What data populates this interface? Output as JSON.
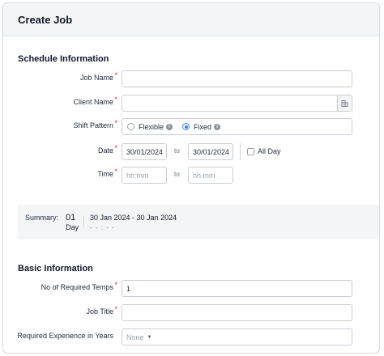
{
  "modal": {
    "title": "Create Job"
  },
  "schedule": {
    "section_title": "Schedule Information",
    "job_name": {
      "label": "Job Name",
      "value": ""
    },
    "client_name": {
      "label": "Client Name",
      "value": ""
    },
    "shift_pattern": {
      "label": "Shift Pattern",
      "options": [
        "Flexible",
        "Fixed"
      ],
      "selected": "Fixed"
    },
    "date": {
      "label": "Date",
      "from": "30/01/2024",
      "to_label": "to",
      "to": "30/01/2024",
      "all_day_label": "All Day",
      "all_day_checked": false
    },
    "time": {
      "label": "Time",
      "from_placeholder": "hh:mm",
      "to_label": "to",
      "to_placeholder": "hh:mm"
    }
  },
  "summary": {
    "label": "Summary:",
    "days_count": "01",
    "days_unit": "Day",
    "date_range": "30 Jan 2024 - 30 Jan 2024",
    "time_range": "- - : - -"
  },
  "basic": {
    "section_title": "Basic Information",
    "required_temps": {
      "label": "No of Required Temps",
      "value": "1"
    },
    "job_title": {
      "label": "Job Title",
      "value": ""
    },
    "required_experience": {
      "label": "Required Experience in Years",
      "value": "None"
    }
  },
  "colors": {
    "accent": "#3b82f6",
    "required": "#dc2626",
    "header_bg": "#f4f5f7"
  },
  "icons": {
    "client_lookup": "building-icon",
    "info": "info-icon",
    "dropdown": "caret-down-icon"
  }
}
